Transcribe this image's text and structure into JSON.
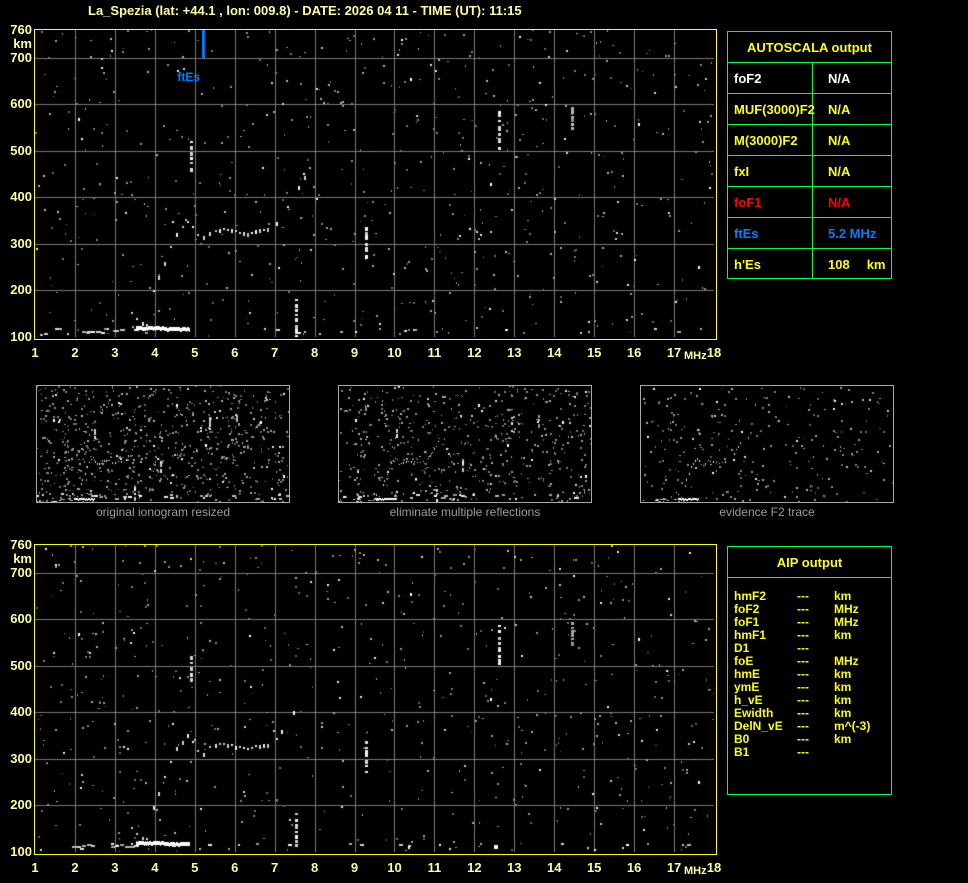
{
  "window": {
    "title": "La_Spezia (lat: +44.1 , lon: 009.8) - DATE: 2026 04 11 - TIME (UT): 11:15"
  },
  "colors": {
    "background": "#000000",
    "title_yellow": "#FFFF9E",
    "plot_border": "#FFFF00",
    "grid": "#7A7A7A",
    "table_green": "#00FF41",
    "label_yellow": "#FFFF00",
    "white": "#FFFFFF",
    "red": "#FF0000",
    "blue": "#0080FF",
    "caption_gray": "#9C9C9C"
  },
  "autoscala_table": {
    "header": "AUTOSCALA output",
    "rows": [
      {
        "label": "foF2",
        "value": "N/A",
        "unit": "",
        "color": "#FFFFFF"
      },
      {
        "label": "MUF(3000)F2",
        "value": "N/A",
        "unit": "",
        "color": "#FFFF00"
      },
      {
        "label": "M(3000)F2",
        "value": "N/A",
        "unit": "",
        "color": "#FFFF00"
      },
      {
        "label": "fxI",
        "value": "N/A",
        "unit": "",
        "color": "#FFFF00"
      },
      {
        "label": "foF1",
        "value": "N/A",
        "unit": "",
        "color": "#FF0000"
      },
      {
        "label": "ftEs",
        "value": "5.2 MHz",
        "unit": "",
        "color": "#0080FF"
      },
      {
        "label": "h'Es",
        "value": "108",
        "unit": "km",
        "color": "#FFFF00"
      }
    ]
  },
  "aip_table": {
    "header": "AIP output",
    "rows": [
      {
        "label": "hmF2",
        "value": "---",
        "unit": "km"
      },
      {
        "label": "foF2",
        "value": "---",
        "unit": "MHz"
      },
      {
        "label": "foF1",
        "value": "---",
        "unit": "MHz"
      },
      {
        "label": "hmF1",
        "value": "---",
        "unit": "km"
      },
      {
        "label": "D1",
        "value": "---",
        "unit": ""
      },
      {
        "label": "foE",
        "value": "---",
        "unit": "MHz"
      },
      {
        "label": "hmE",
        "value": "---",
        "unit": "km"
      },
      {
        "label": "ymE",
        "value": "---",
        "unit": "km"
      },
      {
        "label": "h_vE",
        "value": "---",
        "unit": "km"
      },
      {
        "label": "Ewidth",
        "value": "---",
        "unit": "km"
      },
      {
        "label": "DelN_vE",
        "value": "---",
        "unit": "m^(-3)"
      },
      {
        "label": "B0",
        "value": "---",
        "unit": "km"
      },
      {
        "label": "B1",
        "value": "---",
        "unit": ""
      }
    ]
  },
  "thumbnails": {
    "captions": [
      "original ionogram resized",
      "eliminate multiple reflections",
      "evidence F2 trace"
    ]
  },
  "chart_data": {
    "type": "scatter",
    "title": "Ionogram, La_Spezia, 2026-04-11 11:15 UT",
    "xlabel": "MHz",
    "ylabel": "km",
    "x_ticks": [
      1,
      2,
      3,
      4,
      5,
      6,
      7,
      8,
      9,
      10,
      11,
      12,
      13,
      14,
      15,
      16,
      17,
      18
    ],
    "y_ticks": [
      760,
      700,
      600,
      500,
      400,
      300,
      200,
      100
    ],
    "xlim": [
      1,
      18
    ],
    "ylim": [
      100,
      760
    ],
    "grid": true,
    "marker": {
      "name": "ftEs",
      "freq_mhz": 5.2,
      "color": "#0080FF",
      "top_km": 760,
      "bottom_km": 700
    },
    "scaled_values": {
      "ftEs_MHz": 5.2,
      "hEs_km": 108
    },
    "traces": [
      {
        "name": "Es-layer-dashes",
        "kind": "dashes",
        "from": [
          1.95,
          112
        ],
        "to": [
          3.5,
          114
        ],
        "n": 14
      },
      {
        "name": "corner-blob",
        "kind": "curve",
        "pts": [
          [
            1.05,
            100
          ],
          [
            1.15,
            106
          ],
          [
            1.28,
            111
          ]
        ]
      },
      {
        "name": "Es-layer-solid",
        "kind": "thick",
        "from": [
          3.55,
          122
        ],
        "to": [
          4.9,
          121
        ]
      },
      {
        "name": "Es-cusp",
        "kind": "curve",
        "pts": [
          [
            3.42,
            152
          ],
          [
            3.55,
            139
          ],
          [
            3.7,
            130
          ],
          [
            3.88,
            124
          ]
        ]
      },
      {
        "name": "F-trace-riser",
        "kind": "curve",
        "pts": [
          [
            3.97,
            200
          ],
          [
            4.1,
            228
          ],
          [
            4.25,
            262
          ],
          [
            4.4,
            296
          ],
          [
            4.55,
            322
          ],
          [
            4.7,
            340
          ],
          [
            4.82,
            351
          ]
        ]
      },
      {
        "name": "F-trace-flat",
        "kind": "curve",
        "pts": [
          [
            4.82,
            351
          ],
          [
            4.95,
            336
          ],
          [
            5.08,
            318
          ],
          [
            5.22,
            314
          ],
          [
            5.38,
            324
          ],
          [
            5.52,
            331
          ],
          [
            5.72,
            334
          ],
          [
            5.92,
            331
          ],
          [
            6.12,
            325
          ],
          [
            6.32,
            322
          ],
          [
            6.52,
            327
          ],
          [
            6.72,
            331
          ],
          [
            6.92,
            334
          ]
        ]
      },
      {
        "name": "F-trace-rise-right",
        "kind": "dots",
        "pts": [
          [
            7.05,
            344
          ],
          [
            7.18,
            360
          ],
          [
            7.32,
            380
          ],
          [
            7.46,
            400
          ],
          [
            7.6,
            422
          ],
          [
            7.74,
            444
          ],
          [
            7.88,
            463
          ]
        ]
      },
      {
        "name": "echo-4.9MHz",
        "kind": "vdash",
        "f": 4.87,
        "from_km": 465,
        "to_km": 520
      },
      {
        "name": "echo-7.5MHz",
        "kind": "vdash",
        "f": 7.51,
        "from_km": 106,
        "to_km": 184
      },
      {
        "name": "echo-9.3MHz",
        "kind": "vdash",
        "f": 9.27,
        "from_km": 266,
        "to_km": 338
      },
      {
        "name": "echo-12.6MHz",
        "kind": "vdash",
        "f": 12.6,
        "from_km": 505,
        "to_km": 588
      },
      {
        "name": "echo-14.4MHz",
        "kind": "vdash",
        "f": 14.42,
        "from_km": 550,
        "to_km": 595,
        "dim": true
      }
    ],
    "bright_dots": [
      [
        16.1,
        559
      ],
      [
        17.62,
        252
      ],
      [
        10.4,
        655
      ],
      [
        2.1,
        570
      ],
      [
        12.4,
        430
      ]
    ],
    "speckle": {
      "top_seed": 7,
      "bottom_seed": 131,
      "thumb_seeds": [
        21,
        55,
        99
      ],
      "gray_dots": 560,
      "white_dots": 75,
      "thumb_gray_dots": [
        700,
        520,
        250
      ],
      "thumb_white_dots": [
        45,
        38,
        22
      ]
    }
  }
}
